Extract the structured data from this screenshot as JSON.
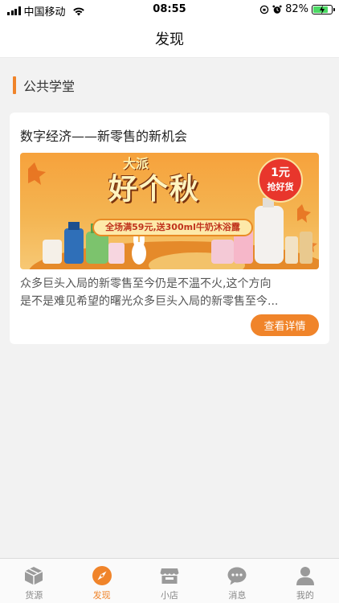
{
  "status_bar": {
    "carrier": "中国移动",
    "time": "08:55",
    "battery": "82%",
    "battery_level": 0.82
  },
  "nav": {
    "title": "发现"
  },
  "section": {
    "title": "公共学堂"
  },
  "article": {
    "title": "数字经济——新零售的新机会",
    "banner": {
      "headline_top": "大派",
      "headline": "好个秋",
      "badge_price": "1元",
      "badge_text": "抢好货",
      "promo": "全场满59元,送300ml牛奶沐浴露"
    },
    "desc_line1": "众多巨头入局的新零售至今仍是不温不火,这个方向",
    "desc_line2": "是不是难见希望的曙光众多巨头入局的新零售至今...",
    "more_label": "查看详情"
  },
  "colors": {
    "accent": "#f0842a"
  },
  "tabs": [
    {
      "label": "货源",
      "icon": "box-icon",
      "active": false
    },
    {
      "label": "发现",
      "icon": "compass-icon",
      "active": true
    },
    {
      "label": "小店",
      "icon": "shop-icon",
      "active": false
    },
    {
      "label": "消息",
      "icon": "chat-icon",
      "active": false
    },
    {
      "label": "我的",
      "icon": "user-icon",
      "active": false
    }
  ]
}
